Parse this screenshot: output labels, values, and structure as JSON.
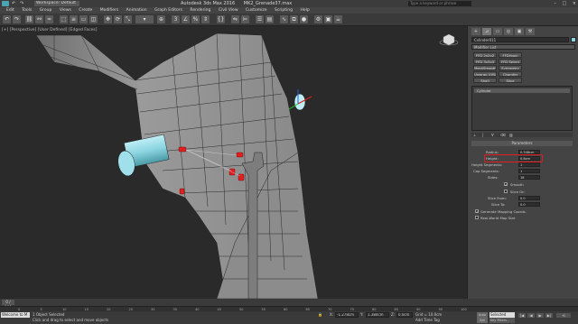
{
  "titlebar": {
    "workspace": "Workspace: Default",
    "app_title": "Autodesk 3ds Max 2016",
    "file_name": "MK2_Grenade37.max",
    "search_placeholder": "Type a keyword or phrase",
    "buttons": [
      "–",
      "□",
      "×"
    ]
  },
  "menubar": {
    "items": [
      "Edit",
      "Tools",
      "Group",
      "Views",
      "Create",
      "Modifiers",
      "Animation",
      "Graph Editors",
      "Rendering",
      "Civil View",
      "Customize",
      "Scripting",
      "Help"
    ]
  },
  "viewport": {
    "label": "[+] [Perspective] [User Defined] [Edged Faces]"
  },
  "command_panel": {
    "tabs": [
      "+",
      "⊿",
      "▭",
      "◎",
      "▣",
      "⚒"
    ],
    "object_name": "Cylinder011",
    "modifier_list": "Modifier List",
    "buttons": [
      "FFD 2x2x2",
      "FFD(box)",
      "FFD 3x3x3",
      "FFD Select",
      "MeshSmooth",
      "Symmetry",
      "Unwrap UVW",
      "Chamfer",
      "Shell",
      "Slice"
    ],
    "stack_item": "Cylinder",
    "rollout_title": "Parameters",
    "params": [
      {
        "label": "Radius:",
        "value": "0.348cm"
      },
      {
        "label": "Height:",
        "value": "0.8cm"
      },
      {
        "label": "Height Segments:",
        "value": "1"
      },
      {
        "label": "Cap Segments:",
        "value": "1"
      },
      {
        "label": "Sides:",
        "value": "18"
      }
    ],
    "smooth_label": "Smooth",
    "slice_on_label": "Slice On",
    "slice_from_label": "Slice From:",
    "slice_to_label": "Slice To:",
    "slice_from_value": "0.0",
    "slice_to_value": "0.0",
    "gen_mapping_label": "Generate Mapping Coords.",
    "real_world_label": "Real-World Map Size"
  },
  "timeline": {
    "frame": "0 / 100",
    "ticks": [
      "0",
      "5",
      "10",
      "15",
      "20",
      "25",
      "30",
      "35",
      "40",
      "45",
      "50",
      "55",
      "60",
      "65",
      "70",
      "75",
      "80",
      "85",
      "90",
      "95",
      "100"
    ]
  },
  "statusbar": {
    "maxscript": "Welcome to M",
    "selected": "1 Object Selected",
    "hint": "Click and drag to select and move objects",
    "x_label": "X:",
    "x_value": "-1.278cm",
    "y_label": "Y:",
    "y_value": "1.384cm",
    "z_label": "Z:",
    "z_value": "0.0cm",
    "grid": "Grid = 10.0cm",
    "add_time_tag": "Add Time Tag",
    "auto_key": "Auto Key",
    "selected_dropdown": "Selected",
    "set_key": "Set Key",
    "key_filters": "Key Filters...",
    "playback": [
      "|◀",
      "◀",
      "▶",
      "▶|",
      "⟲"
    ]
  },
  "colors": {
    "accent_highlight": "#e02020",
    "viewport_bg": "#2a2a2a",
    "mesh_face": "#8e8e8e",
    "wire": "#222222",
    "cylinder": "#8ad4e0"
  }
}
